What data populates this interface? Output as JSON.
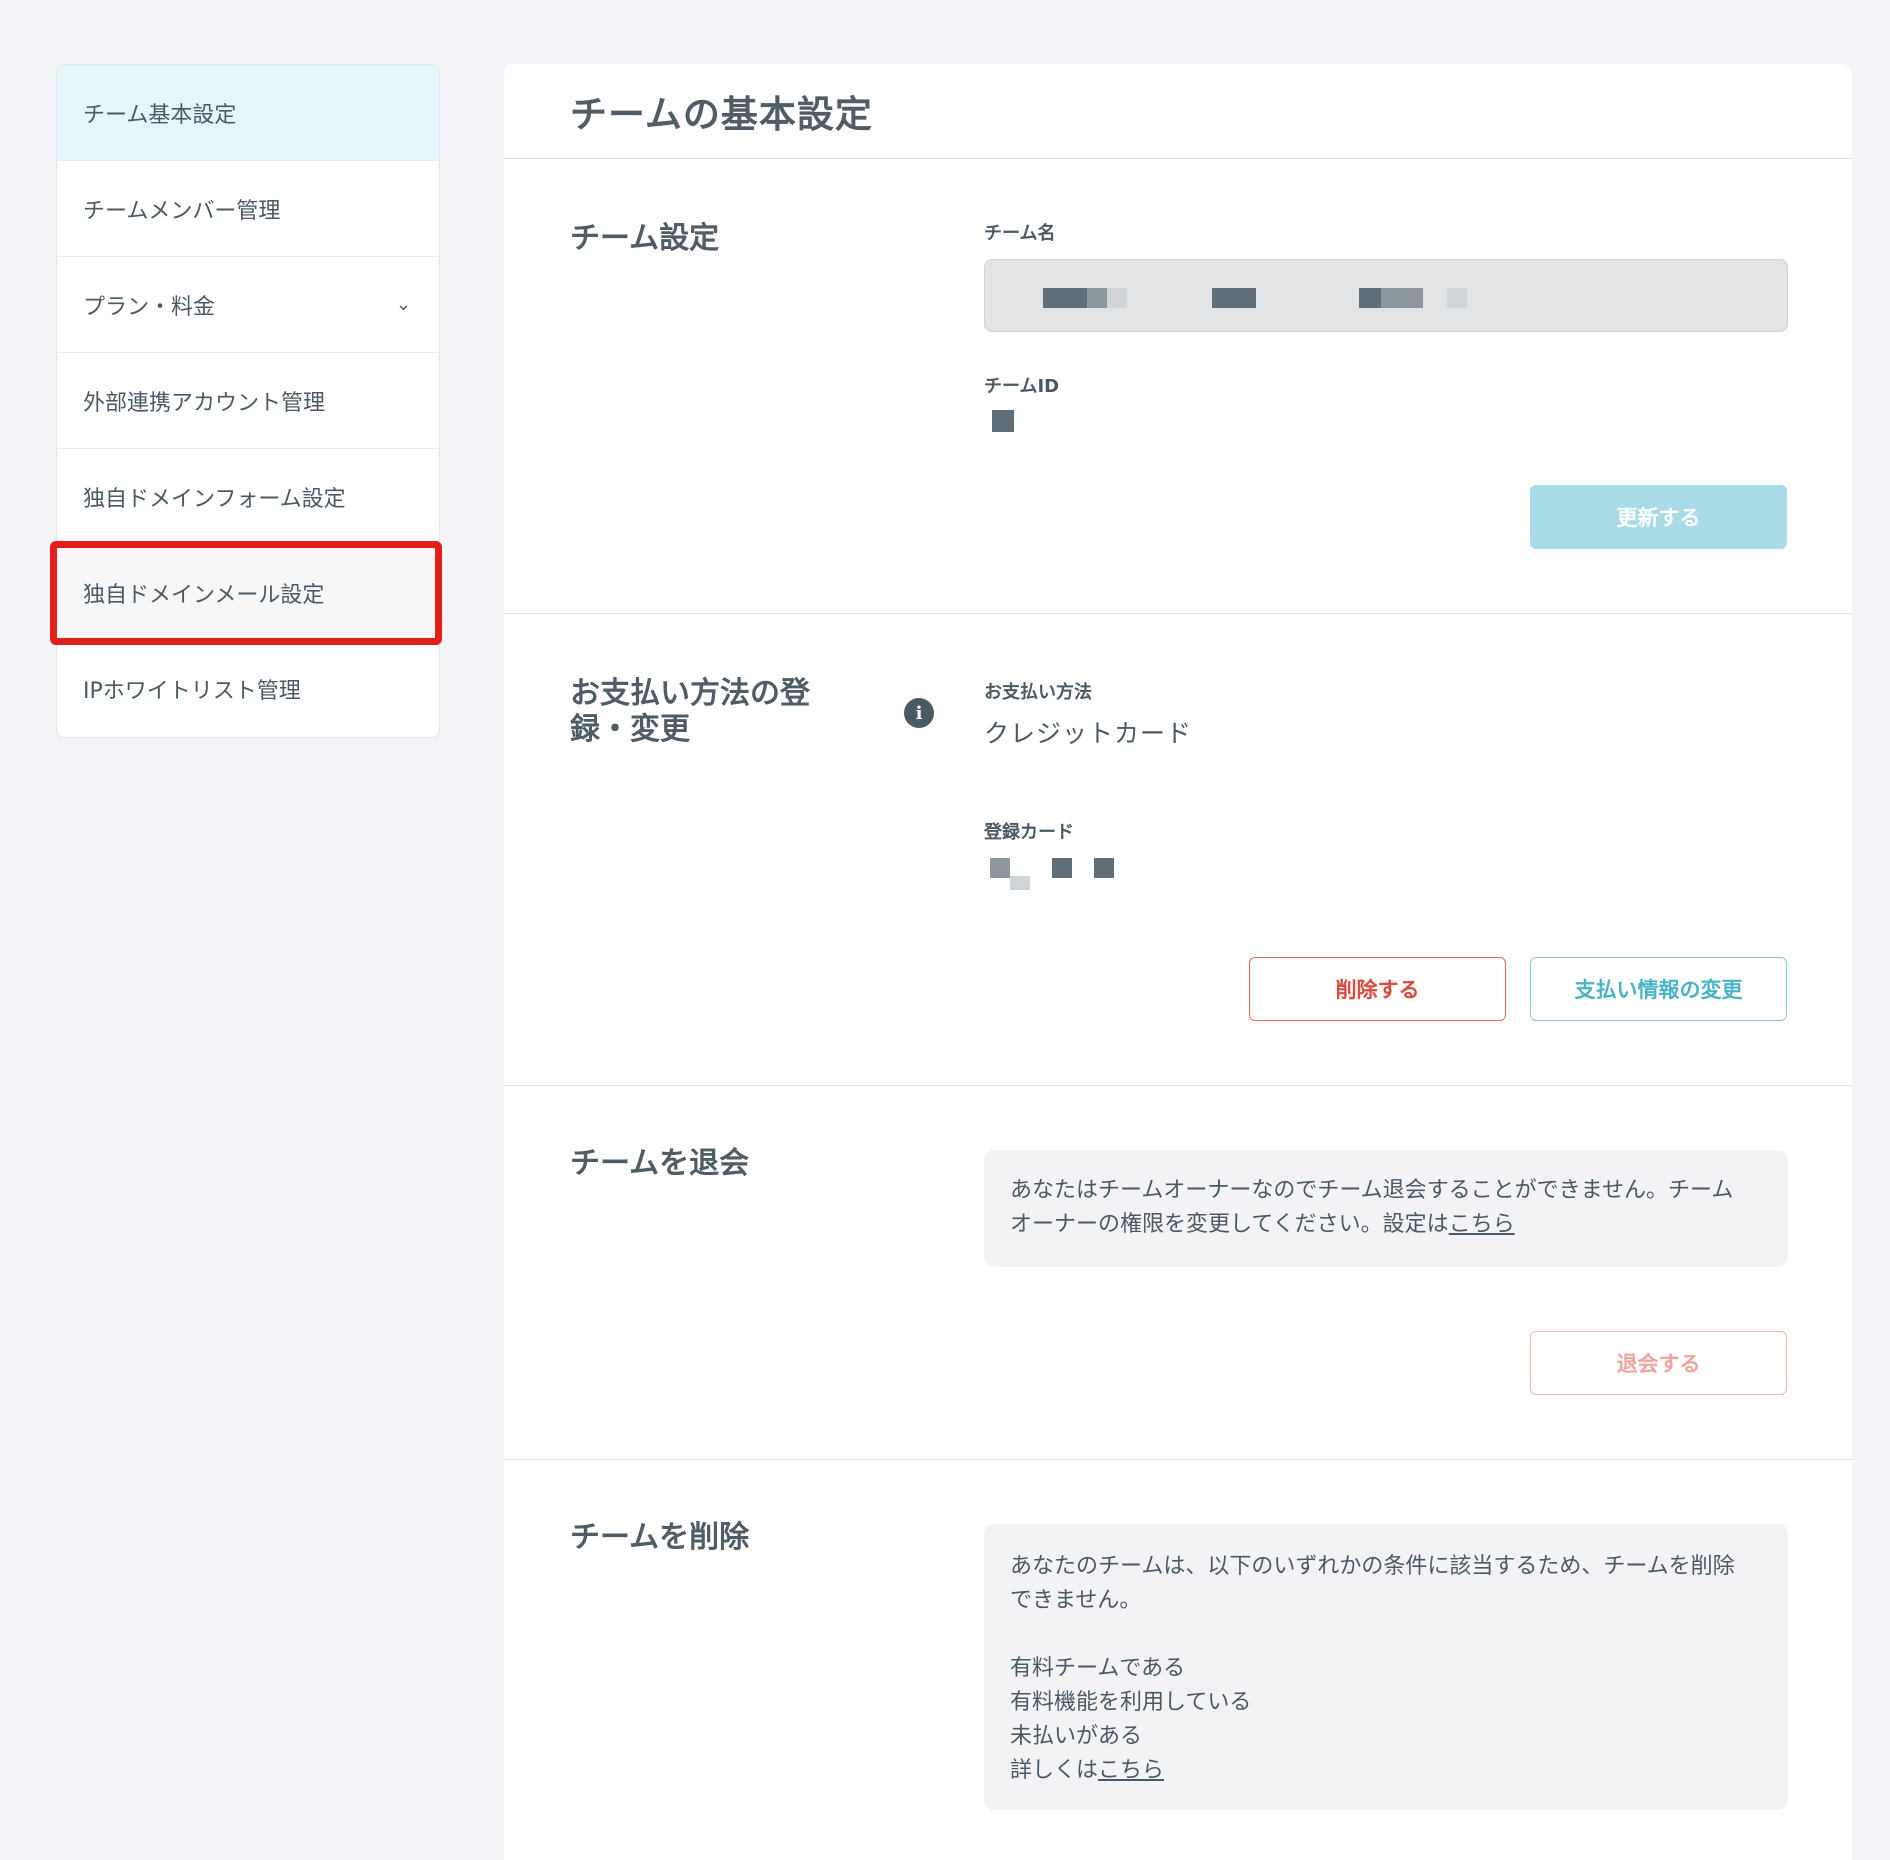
{
  "sidebar": {
    "items": [
      {
        "label": "チーム基本設定"
      },
      {
        "label": "チームメンバー管理"
      },
      {
        "label": "プラン・料金",
        "chevron": "⌄"
      },
      {
        "label": "外部連携アカウント管理"
      },
      {
        "label": "独自ドメインフォーム設定"
      },
      {
        "label": "独自ドメインメール設定"
      },
      {
        "label": "IPホワイトリスト管理"
      }
    ]
  },
  "page": {
    "title": "チームの基本設定"
  },
  "team_settings": {
    "title": "チーム設定",
    "name_label": "チーム名",
    "id_label": "チームID",
    "update_button": "更新する"
  },
  "payment": {
    "title_line1": "お支払い方法の登",
    "title_line2": "録・変更",
    "info_icon": "i",
    "method_label": "お支払い方法",
    "method_value": "クレジットカード",
    "card_label": "登録カード",
    "delete_button": "削除する",
    "change_button": "支払い情報の変更"
  },
  "withdraw": {
    "title": "チームを退会",
    "notice_line1": "あなたはチームオーナーなのでチーム退会することができません。チーム",
    "notice_line2": "オーナーの権限を変更してください。設定は",
    "notice_link": "こちら",
    "button": "退会する"
  },
  "delete_team": {
    "title": "チームを削除",
    "notice_line1": "あなたのチームは、以下のいずれかの条件に該当するため、チームを削除",
    "notice_line2": "できません。",
    "conditions": [
      "有料チームである",
      "有料機能を利用している",
      "未払いがある"
    ],
    "details_prefix": "詳しくは",
    "details_link": "こちら"
  },
  "colors": {
    "accent": "#4cb3c7",
    "danger": "#dd4a3c",
    "highlight": "#e21f1a",
    "active_bg": "#e4f6fa"
  }
}
